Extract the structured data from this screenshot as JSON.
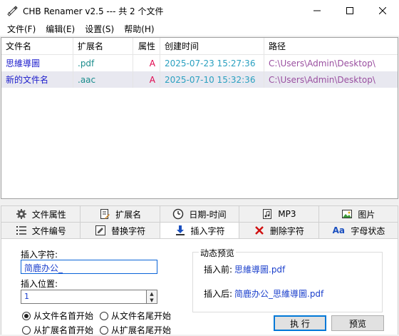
{
  "window": {
    "title": "CHB Renamer v2.5 --- 共 2 个文件",
    "minimize_glyph": "─",
    "maximize_glyph": "☐",
    "close_glyph": "✕"
  },
  "menu": [
    "文件(F)",
    "编辑(E)",
    "设置(S)",
    "帮助(H)"
  ],
  "file_list": {
    "columns": [
      "文件名",
      "扩展名",
      "属性",
      "创建时间",
      "路径"
    ],
    "rows": [
      {
        "name": "思維導圖",
        "ext": ".pdf",
        "attr": "A",
        "created": "2025-07-23 15:27:36",
        "path": "C:\\Users\\Admin\\Desktop\\"
      },
      {
        "name": "新的文件名",
        "ext": ".aac",
        "attr": "A",
        "created": "2025-07-10 15:32:36",
        "path": "C:\\Users\\Admin\\Desktop\\"
      }
    ]
  },
  "tabs_row1": [
    {
      "label": "文件属性",
      "icon": "gear-icon"
    },
    {
      "label": "扩展名",
      "icon": "document-edit-icon"
    },
    {
      "label": "日期-时间",
      "icon": "clock-icon"
    },
    {
      "label": "MP3",
      "icon": "music-file-icon"
    },
    {
      "label": "图片",
      "icon": "image-icon"
    }
  ],
  "tabs_row2": [
    {
      "label": "文件编号",
      "icon": "numbered-list-icon"
    },
    {
      "label": "替换字符",
      "icon": "replace-icon"
    },
    {
      "label": "插入字符",
      "icon": "insert-icon"
    },
    {
      "label": "删除字符",
      "icon": "delete-x-icon"
    },
    {
      "label": "字母状态",
      "icon": "letter-case-icon"
    }
  ],
  "insert_panel": {
    "insert_text_label": "插入字符:",
    "insert_text_value": "简鹿办公_",
    "position_label": "插入位置:",
    "position_value": "1",
    "radio_options": [
      "从文件名首开始",
      "从文件名尾开始",
      "从扩展名首开始",
      "从扩展名尾开始"
    ],
    "selected_radio": 0,
    "preview_title": "动态预览",
    "before_label": "插入前:",
    "before_value": "思維導圖.pdf",
    "after_label": "插入后:",
    "after_value": "简鹿办公_思維導圖.pdf",
    "execute_label": "执 行",
    "preview_label": "预览"
  },
  "colors": {
    "name": "#1c1ccc",
    "ext": "#1a8c8c",
    "attr": "#e0004a",
    "created": "#2aa0c0",
    "path": "#9a4fa0",
    "value_blue": "#1a3fcc"
  }
}
